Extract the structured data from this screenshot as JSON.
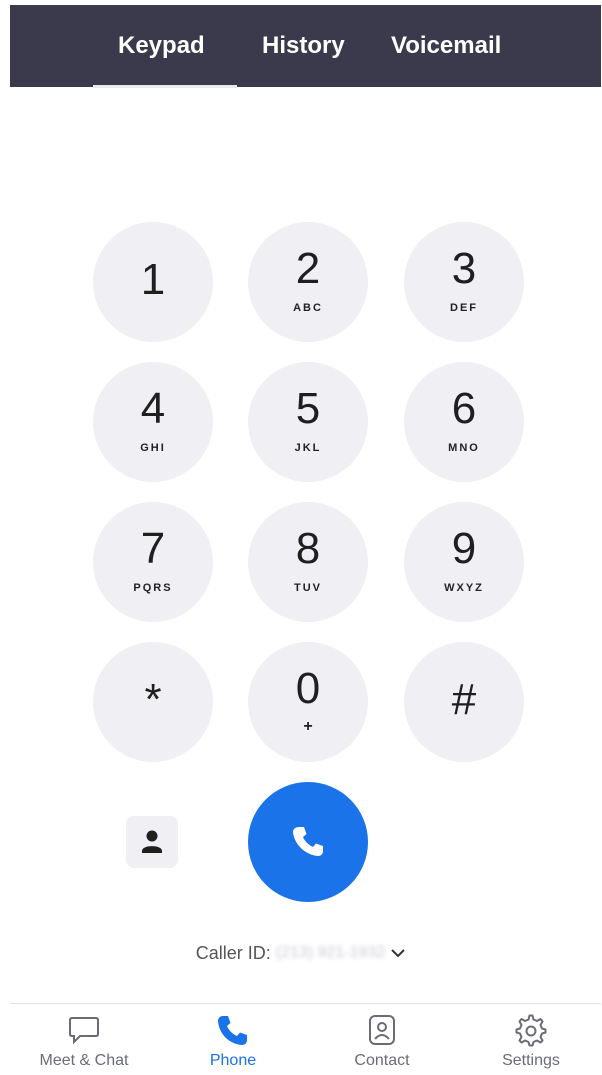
{
  "tabs": {
    "keypad": "Keypad",
    "history": "History",
    "voicemail": "Voicemail",
    "active": "Keypad"
  },
  "keypad": {
    "keys": [
      {
        "digit": "1",
        "letters": ""
      },
      {
        "digit": "2",
        "letters": "ABC"
      },
      {
        "digit": "3",
        "letters": "DEF"
      },
      {
        "digit": "4",
        "letters": "GHI"
      },
      {
        "digit": "5",
        "letters": "JKL"
      },
      {
        "digit": "6",
        "letters": "MNO"
      },
      {
        "digit": "7",
        "letters": "PQRS"
      },
      {
        "digit": "8",
        "letters": "TUV"
      },
      {
        "digit": "9",
        "letters": "WXYZ"
      },
      {
        "digit": "*",
        "letters": ""
      },
      {
        "digit": "0",
        "letters": "+"
      },
      {
        "digit": "#",
        "letters": ""
      }
    ]
  },
  "actions": {
    "contact_icon": "person-icon",
    "call_icon": "phone-icon"
  },
  "caller_id": {
    "label": "Caller ID:",
    "value": "(213) 921-1932"
  },
  "bottom_nav": {
    "items": [
      {
        "label": "Meet & Chat",
        "icon": "chat-bubble-icon"
      },
      {
        "label": "Phone",
        "icon": "phone-icon"
      },
      {
        "label": "Contact",
        "icon": "contact-icon"
      },
      {
        "label": "Settings",
        "icon": "gear-icon"
      }
    ],
    "active": "Phone"
  },
  "colors": {
    "header_bg": "#3b3a4d",
    "accent": "#1a73e8",
    "key_bg": "#efeff4"
  }
}
